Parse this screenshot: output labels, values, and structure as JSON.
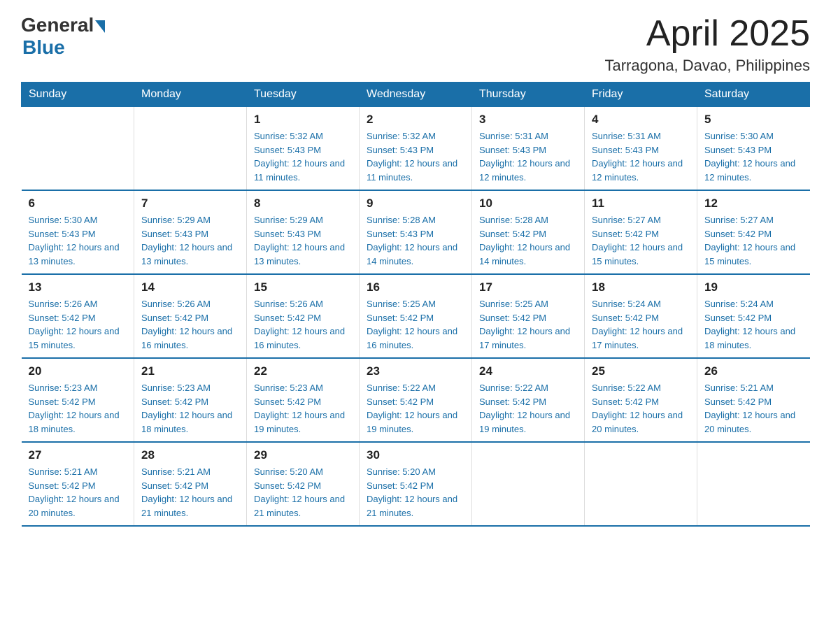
{
  "header": {
    "logo_general": "General",
    "logo_blue": "Blue",
    "month_title": "April 2025",
    "location": "Tarragona, Davao, Philippines"
  },
  "days_of_week": [
    "Sunday",
    "Monday",
    "Tuesday",
    "Wednesday",
    "Thursday",
    "Friday",
    "Saturday"
  ],
  "weeks": [
    [
      null,
      null,
      {
        "day": "1",
        "sunrise": "5:32 AM",
        "sunset": "5:43 PM",
        "daylight": "12 hours and 11 minutes."
      },
      {
        "day": "2",
        "sunrise": "5:32 AM",
        "sunset": "5:43 PM",
        "daylight": "12 hours and 11 minutes."
      },
      {
        "day": "3",
        "sunrise": "5:31 AM",
        "sunset": "5:43 PM",
        "daylight": "12 hours and 12 minutes."
      },
      {
        "day": "4",
        "sunrise": "5:31 AM",
        "sunset": "5:43 PM",
        "daylight": "12 hours and 12 minutes."
      },
      {
        "day": "5",
        "sunrise": "5:30 AM",
        "sunset": "5:43 PM",
        "daylight": "12 hours and 12 minutes."
      }
    ],
    [
      {
        "day": "6",
        "sunrise": "5:30 AM",
        "sunset": "5:43 PM",
        "daylight": "12 hours and 13 minutes."
      },
      {
        "day": "7",
        "sunrise": "5:29 AM",
        "sunset": "5:43 PM",
        "daylight": "12 hours and 13 minutes."
      },
      {
        "day": "8",
        "sunrise": "5:29 AM",
        "sunset": "5:43 PM",
        "daylight": "12 hours and 13 minutes."
      },
      {
        "day": "9",
        "sunrise": "5:28 AM",
        "sunset": "5:43 PM",
        "daylight": "12 hours and 14 minutes."
      },
      {
        "day": "10",
        "sunrise": "5:28 AM",
        "sunset": "5:42 PM",
        "daylight": "12 hours and 14 minutes."
      },
      {
        "day": "11",
        "sunrise": "5:27 AM",
        "sunset": "5:42 PM",
        "daylight": "12 hours and 15 minutes."
      },
      {
        "day": "12",
        "sunrise": "5:27 AM",
        "sunset": "5:42 PM",
        "daylight": "12 hours and 15 minutes."
      }
    ],
    [
      {
        "day": "13",
        "sunrise": "5:26 AM",
        "sunset": "5:42 PM",
        "daylight": "12 hours and 15 minutes."
      },
      {
        "day": "14",
        "sunrise": "5:26 AM",
        "sunset": "5:42 PM",
        "daylight": "12 hours and 16 minutes."
      },
      {
        "day": "15",
        "sunrise": "5:26 AM",
        "sunset": "5:42 PM",
        "daylight": "12 hours and 16 minutes."
      },
      {
        "day": "16",
        "sunrise": "5:25 AM",
        "sunset": "5:42 PM",
        "daylight": "12 hours and 16 minutes."
      },
      {
        "day": "17",
        "sunrise": "5:25 AM",
        "sunset": "5:42 PM",
        "daylight": "12 hours and 17 minutes."
      },
      {
        "day": "18",
        "sunrise": "5:24 AM",
        "sunset": "5:42 PM",
        "daylight": "12 hours and 17 minutes."
      },
      {
        "day": "19",
        "sunrise": "5:24 AM",
        "sunset": "5:42 PM",
        "daylight": "12 hours and 18 minutes."
      }
    ],
    [
      {
        "day": "20",
        "sunrise": "5:23 AM",
        "sunset": "5:42 PM",
        "daylight": "12 hours and 18 minutes."
      },
      {
        "day": "21",
        "sunrise": "5:23 AM",
        "sunset": "5:42 PM",
        "daylight": "12 hours and 18 minutes."
      },
      {
        "day": "22",
        "sunrise": "5:23 AM",
        "sunset": "5:42 PM",
        "daylight": "12 hours and 19 minutes."
      },
      {
        "day": "23",
        "sunrise": "5:22 AM",
        "sunset": "5:42 PM",
        "daylight": "12 hours and 19 minutes."
      },
      {
        "day": "24",
        "sunrise": "5:22 AM",
        "sunset": "5:42 PM",
        "daylight": "12 hours and 19 minutes."
      },
      {
        "day": "25",
        "sunrise": "5:22 AM",
        "sunset": "5:42 PM",
        "daylight": "12 hours and 20 minutes."
      },
      {
        "day": "26",
        "sunrise": "5:21 AM",
        "sunset": "5:42 PM",
        "daylight": "12 hours and 20 minutes."
      }
    ],
    [
      {
        "day": "27",
        "sunrise": "5:21 AM",
        "sunset": "5:42 PM",
        "daylight": "12 hours and 20 minutes."
      },
      {
        "day": "28",
        "sunrise": "5:21 AM",
        "sunset": "5:42 PM",
        "daylight": "12 hours and 21 minutes."
      },
      {
        "day": "29",
        "sunrise": "5:20 AM",
        "sunset": "5:42 PM",
        "daylight": "12 hours and 21 minutes."
      },
      {
        "day": "30",
        "sunrise": "5:20 AM",
        "sunset": "5:42 PM",
        "daylight": "12 hours and 21 minutes."
      },
      null,
      null,
      null
    ]
  ],
  "labels": {
    "sunrise_prefix": "Sunrise: ",
    "sunset_prefix": "Sunset: ",
    "daylight_prefix": "Daylight: "
  }
}
